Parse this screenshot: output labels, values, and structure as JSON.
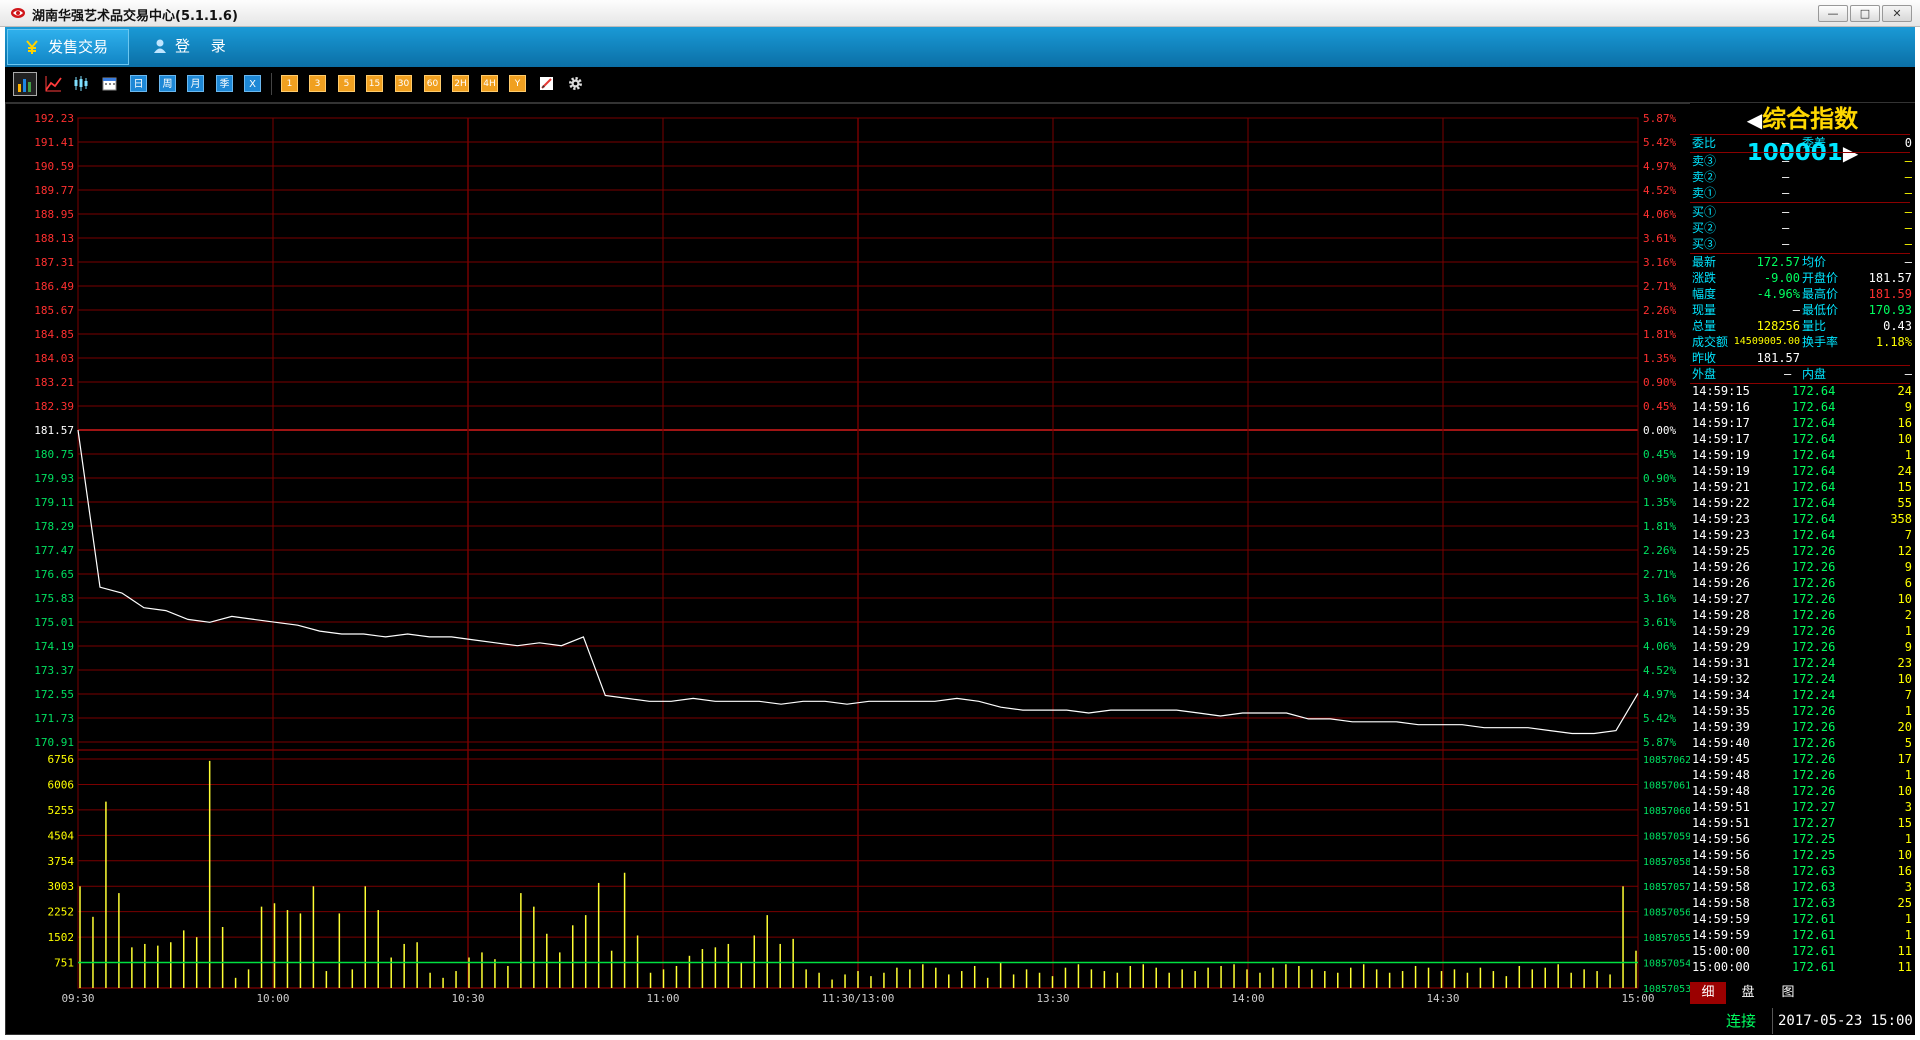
{
  "window": {
    "title": "湖南华强艺术品交易中心(5.1.1.6)",
    "min_label": "—",
    "max_label": "□",
    "close_label": "✕"
  },
  "menu": {
    "trade_label": "发售交易",
    "login_label": "登 录"
  },
  "toolbar": {
    "period_buttons": [
      "日",
      "周",
      "月",
      "季",
      "X"
    ],
    "minute_buttons": [
      "1",
      "3",
      "5",
      "15",
      "30",
      "60",
      "2H",
      "4H",
      "Y"
    ]
  },
  "quote": {
    "name": "综合指数",
    "code": "100001",
    "weibi_label": "委比",
    "weibi_value": "—",
    "weicha_label": "委差",
    "weicha_value": "0",
    "sell_rows": [
      {
        "label": "卖③",
        "price": "—",
        "vol": "—"
      },
      {
        "label": "卖②",
        "price": "—",
        "vol": "—"
      },
      {
        "label": "卖①",
        "price": "—",
        "vol": "—"
      }
    ],
    "buy_rows": [
      {
        "label": "买①",
        "price": "—",
        "vol": "—"
      },
      {
        "label": "买②",
        "price": "—",
        "vol": "—"
      },
      {
        "label": "买③",
        "price": "—",
        "vol": "—"
      }
    ],
    "stats": [
      {
        "l1": "最新",
        "v1": "172.57",
        "l2": "均价",
        "v2": "—",
        "c1": "#00ff60",
        "c2": "#fff"
      },
      {
        "l1": "涨跌",
        "v1": "-9.00",
        "l2": "开盘价",
        "v2": "181.57",
        "c1": "#00ff60",
        "c2": "#fff"
      },
      {
        "l1": "幅度",
        "v1": "-4.96%",
        "l2": "最高价",
        "v2": "181.59",
        "c1": "#00ff60",
        "c2": "#ff3030"
      },
      {
        "l1": "现量",
        "v1": "—",
        "l2": "最低价",
        "v2": "170.93",
        "c1": "#fff",
        "c2": "#00ff60"
      },
      {
        "l1": "总量",
        "v1": "128256",
        "l2": "量比",
        "v2": "0.43",
        "c1": "#ffff00",
        "c2": "#fff"
      },
      {
        "l1": "成交额",
        "v1": "14509005.00",
        "l2": "换手率",
        "v2": "1.18%",
        "c1": "#ffff00",
        "c2": "#ffff00"
      },
      {
        "l1": "昨收",
        "v1": "181.57",
        "l2": "",
        "v2": "",
        "c1": "#fff",
        "c2": "#fff"
      }
    ],
    "outer_label": "外盘",
    "outer_value": "—",
    "inner_label": "内盘",
    "inner_value": "—",
    "ticks": [
      [
        "14:59:15",
        "172.64",
        "24"
      ],
      [
        "14:59:16",
        "172.64",
        "9"
      ],
      [
        "14:59:17",
        "172.64",
        "16"
      ],
      [
        "14:59:17",
        "172.64",
        "10"
      ],
      [
        "14:59:19",
        "172.64",
        "1"
      ],
      [
        "14:59:19",
        "172.64",
        "24"
      ],
      [
        "14:59:21",
        "172.64",
        "15"
      ],
      [
        "14:59:22",
        "172.64",
        "55"
      ],
      [
        "14:59:23",
        "172.64",
        "358"
      ],
      [
        "14:59:23",
        "172.64",
        "7"
      ],
      [
        "14:59:25",
        "172.26",
        "12"
      ],
      [
        "14:59:26",
        "172.26",
        "9"
      ],
      [
        "14:59:26",
        "172.26",
        "6"
      ],
      [
        "14:59:27",
        "172.26",
        "10"
      ],
      [
        "14:59:28",
        "172.26",
        "2"
      ],
      [
        "14:59:29",
        "172.26",
        "1"
      ],
      [
        "14:59:29",
        "172.26",
        "9"
      ],
      [
        "14:59:31",
        "172.24",
        "23"
      ],
      [
        "14:59:32",
        "172.24",
        "10"
      ],
      [
        "14:59:34",
        "172.24",
        "7"
      ],
      [
        "14:59:35",
        "172.26",
        "1"
      ],
      [
        "14:59:39",
        "172.26",
        "20"
      ],
      [
        "14:59:40",
        "172.26",
        "5"
      ],
      [
        "14:59:45",
        "172.26",
        "17"
      ],
      [
        "14:59:48",
        "172.26",
        "1"
      ],
      [
        "14:59:48",
        "172.26",
        "10"
      ],
      [
        "14:59:51",
        "172.27",
        "3"
      ],
      [
        "14:59:51",
        "172.27",
        "15"
      ],
      [
        "14:59:56",
        "172.25",
        "1"
      ],
      [
        "14:59:56",
        "172.25",
        "10"
      ],
      [
        "14:59:58",
        "172.63",
        "16"
      ],
      [
        "14:59:58",
        "172.63",
        "3"
      ],
      [
        "14:59:58",
        "172.63",
        "25"
      ],
      [
        "14:59:59",
        "172.61",
        "1"
      ],
      [
        "14:59:59",
        "172.61",
        "1"
      ],
      [
        "15:00:00",
        "172.61",
        "11"
      ],
      [
        "15:00:00",
        "172.61",
        "11"
      ]
    ],
    "tabs": [
      "细",
      "盘",
      "图"
    ],
    "status_connected": "连接",
    "status_time": "2017-05-23 15:00"
  },
  "chart_data": [
    {
      "type": "line",
      "title": "",
      "x_ticks": [
        "09:30",
        "10:00",
        "10:30",
        "11:00",
        "11:30/13:00",
        "13:30",
        "14:00",
        "14:30",
        "15:00"
      ],
      "y_ticks": [
        "192.23",
        "191.41",
        "190.59",
        "189.77",
        "188.95",
        "188.13",
        "187.31",
        "186.49",
        "185.67",
        "184.85",
        "184.03",
        "183.21",
        "182.39",
        "181.57",
        "180.75",
        "179.93",
        "179.11",
        "178.29",
        "177.47",
        "176.65",
        "175.83",
        "175.01",
        "174.19",
        "173.37",
        "172.55",
        "171.73",
        "170.91"
      ],
      "y_ticks_right": [
        "5.87%",
        "5.42%",
        "4.97%",
        "4.52%",
        "4.06%",
        "3.61%",
        "3.16%",
        "2.71%",
        "2.26%",
        "1.81%",
        "1.35%",
        "0.90%",
        "0.45%",
        "0.00%",
        "0.45%",
        "0.90%",
        "1.35%",
        "1.81%",
        "2.26%",
        "2.71%",
        "3.16%",
        "3.61%",
        "4.06%",
        "4.52%",
        "4.97%",
        "5.42%",
        "5.87%"
      ],
      "ylim": [
        170.91,
        192.23
      ],
      "prev_close": 181.57,
      "series": [
        {
          "values": [
            181.57,
            176.2,
            176.0,
            175.5,
            175.4,
            175.1,
            175.0,
            175.2,
            175.1,
            175.0,
            174.9,
            174.7,
            174.6,
            174.6,
            174.5,
            174.6,
            174.5,
            174.5,
            174.4,
            174.3,
            174.2,
            174.3,
            174.2,
            174.5,
            172.5,
            172.4,
            172.3,
            172.3,
            172.4,
            172.3,
            172.3,
            172.3,
            172.2,
            172.3,
            172.3,
            172.2,
            172.3,
            172.3,
            172.3,
            172.3,
            172.4,
            172.3,
            172.1,
            172.0,
            172.0,
            172.0,
            171.9,
            172.0,
            172.0,
            172.0,
            172.0,
            171.9,
            171.8,
            171.9,
            171.9,
            171.9,
            171.7,
            171.7,
            171.6,
            171.6,
            171.6,
            171.5,
            171.5,
            171.5,
            171.4,
            171.4,
            171.4,
            171.3,
            171.2,
            171.2,
            171.3,
            172.57
          ]
        }
      ]
    },
    {
      "type": "bar",
      "title": "",
      "x_ticks": [
        "09:30",
        "10:00",
        "10:30",
        "11:00",
        "11:30/13:00",
        "13:30",
        "14:00",
        "14:30",
        "15:00"
      ],
      "y_ticks": [
        "6756",
        "6006",
        "5255",
        "4504",
        "3754",
        "3003",
        "2252",
        "1502",
        "751"
      ],
      "y_ticks_right": [
        "10857062",
        "10857061",
        "10857060",
        "10857059",
        "10857058",
        "10857057",
        "10857056",
        "10857055",
        "10857054",
        "10857053"
      ],
      "ylim": [
        0,
        6756
      ],
      "reference_level": 751,
      "values": [
        3000,
        2100,
        5500,
        2800,
        1200,
        1300,
        1250,
        1350,
        1700,
        1500,
        6700,
        1800,
        300,
        550,
        2400,
        2500,
        2300,
        2200,
        3000,
        500,
        2200,
        550,
        3000,
        2300,
        900,
        1300,
        1350,
        450,
        300,
        500,
        900,
        1050,
        850,
        650,
        2800,
        2400,
        1600,
        1050,
        1850,
        2150,
        3100,
        1100,
        3400,
        1550,
        450,
        550,
        650,
        950,
        1150,
        1200,
        1300,
        750,
        1550,
        2150,
        1300,
        1450,
        550,
        450,
        250,
        400,
        500,
        350,
        450,
        600,
        550,
        700,
        600,
        400,
        500,
        650,
        300,
        750,
        400,
        550,
        450,
        350,
        600,
        700,
        550,
        500,
        450,
        650,
        700,
        600,
        450,
        550,
        500,
        600,
        650,
        700,
        550,
        450,
        600,
        700,
        650,
        550,
        500,
        450,
        600,
        700,
        550,
        450,
        500,
        650,
        600,
        500,
        550,
        450,
        600,
        500,
        350,
        650,
        550,
        600,
        700,
        450,
        550,
        500,
        400,
        3000,
        1100
      ]
    }
  ]
}
